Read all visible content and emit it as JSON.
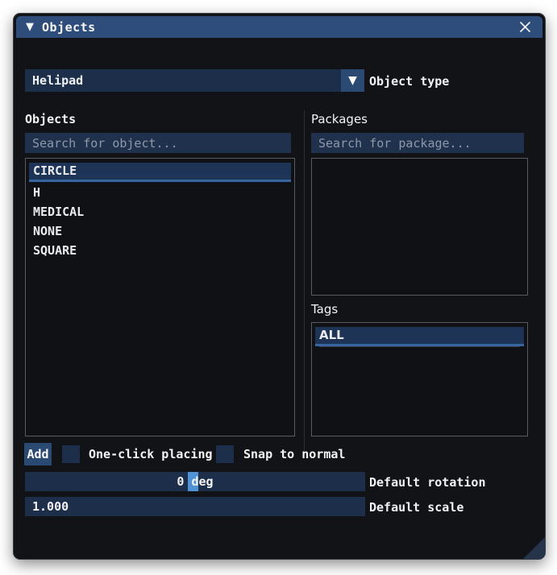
{
  "window": {
    "title": "Objects"
  },
  "icons": {
    "collapse": "▼",
    "dropdown": "▼",
    "close": "x-cross"
  },
  "object_type": {
    "value": "Helipad",
    "label": "Object type"
  },
  "objects_panel": {
    "label": "Objects",
    "search_placeholder": "Search for object...",
    "items": [
      "CIRCLE",
      "H",
      "MEDICAL",
      "NONE",
      "SQUARE"
    ],
    "selected": "CIRCLE"
  },
  "packages_panel": {
    "label": "Packages",
    "search_placeholder": "Search for package...",
    "items": []
  },
  "tags_panel": {
    "label": "Tags",
    "items": [
      "ALL"
    ],
    "selected": "ALL"
  },
  "actions": {
    "add_label": "Add",
    "one_click_label": "One-click placing",
    "one_click_checked": false,
    "snap_label": "Snap to normal",
    "snap_checked": false
  },
  "rotation": {
    "value_text": "0 deg",
    "label": "Default rotation"
  },
  "scale": {
    "value": "1.000",
    "label": "Default scale"
  },
  "colors": {
    "title_bar": "#2f4d7b",
    "panel_background": "#121316",
    "field_navy": "#1d2e4b",
    "button_blue": "#2b4a72",
    "selection_blue": "#1e3457",
    "selection_accent": "#36659f",
    "slider_thumb": "#4f93d6",
    "text": "#f2f3f5",
    "placeholder": "#8e98a6"
  }
}
